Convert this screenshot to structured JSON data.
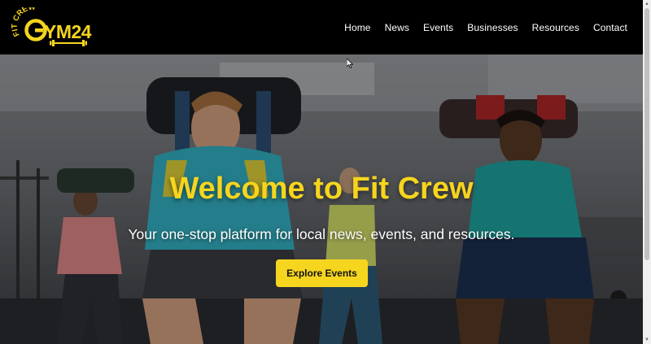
{
  "brand": {
    "name": "Fit Crew Gym24",
    "logo_text_top": "FIT CREW",
    "logo_text_main": "GYM24",
    "color": "#f5d51e"
  },
  "nav": {
    "items": [
      "Home",
      "News",
      "Events",
      "Businesses",
      "Resources",
      "Contact"
    ]
  },
  "hero": {
    "title": "Welcome to Fit Crew",
    "subtitle": "Your one-stop platform for local news, events, and resources.",
    "cta_label": "Explore Events",
    "accent_color": "#f5d51e"
  },
  "icons": {
    "cursor": "cursor-arrow-icon",
    "scroll_up": "scroll-up-arrow-icon",
    "scroll_down": "scroll-down-arrow-icon"
  }
}
